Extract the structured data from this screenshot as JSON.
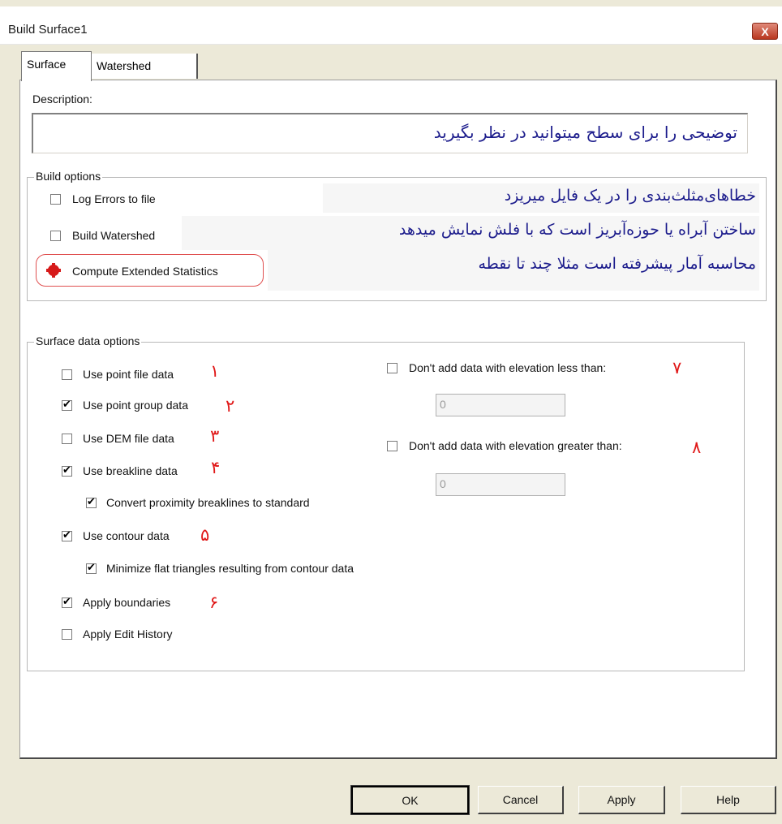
{
  "window": {
    "title": "Build Surface1",
    "close_label": "X"
  },
  "tabs": [
    {
      "label": "Surface"
    },
    {
      "label": "Watershed"
    }
  ],
  "description": {
    "label": "Description:",
    "value": "توضیحی را برای سطح میتوانید در نظر بگیرید"
  },
  "build_options": {
    "title": "Build options",
    "items": [
      {
        "label": "Log Errors to file",
        "checked": false,
        "note": "خطاهای‌مثلث‌بندی را در یک فایل میریزد"
      },
      {
        "label": "Build Watershed",
        "checked": false,
        "note": "ساختن آبراه یا حوزه‌آبریز است که با فلش نمایش میدهد"
      },
      {
        "label": "Compute Extended Statistics",
        "checked": false,
        "note": "محاسبه آمار پیشرفته است مثلا چند تا نقطه"
      }
    ]
  },
  "surface_data_options": {
    "title": "Surface data options",
    "items": [
      {
        "label": "Use point file data",
        "checked": false,
        "marker": "١"
      },
      {
        "label": "Use point group data",
        "checked": true,
        "marker": "٢"
      },
      {
        "label": "Use DEM file data",
        "checked": false,
        "marker": "٣"
      },
      {
        "label": "Use breakline data",
        "checked": true,
        "marker": "۴"
      },
      {
        "label": "Convert proximity breaklines to standard",
        "checked": true,
        "marker": ""
      },
      {
        "label": "Use contour data",
        "checked": true,
        "marker": "۵"
      },
      {
        "label": "Minimize flat triangles resulting from contour data",
        "checked": true,
        "marker": ""
      },
      {
        "label": "Apply boundaries",
        "checked": true,
        "marker": "۶"
      },
      {
        "label": "Apply Edit History",
        "checked": false,
        "marker": ""
      }
    ],
    "elevation": [
      {
        "label": "Don't add data with elevation less than:",
        "checked": false,
        "marker": "٧",
        "value": "0"
      },
      {
        "label": "Don't add data with elevation greater than:",
        "checked": false,
        "marker": "٨",
        "value": "0"
      }
    ]
  },
  "buttons": {
    "ok": "OK",
    "cancel": "Cancel",
    "apply": "Apply",
    "help": "Help"
  },
  "colors": {
    "note_text": "#1c1c8c",
    "marker": "#e01818",
    "highlight": "#e05050"
  }
}
